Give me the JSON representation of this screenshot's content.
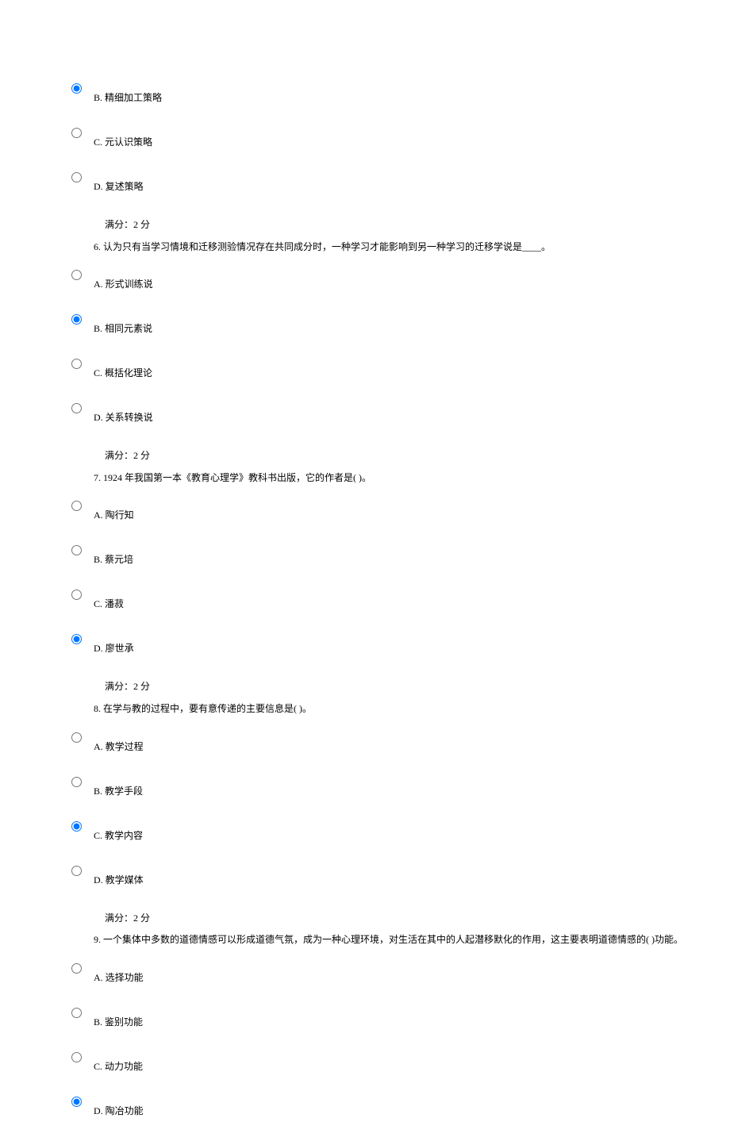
{
  "q5_remainder": {
    "options": [
      {
        "letter": "B",
        "text": "精细加工策略",
        "selected": true
      },
      {
        "letter": "C",
        "text": "元认识策略",
        "selected": false
      },
      {
        "letter": "D",
        "text": "复述策略",
        "selected": false
      }
    ],
    "score": "满分：2 分"
  },
  "q6": {
    "number": "6.",
    "stem": "认为只有当学习情境和迁移测验情况存在共同成分时，一种学习才能影响到另一种学习的迁移学说是____。",
    "options": [
      {
        "letter": "A",
        "text": "形式训练说",
        "selected": false
      },
      {
        "letter": "B",
        "text": "相同元素说",
        "selected": true
      },
      {
        "letter": "C",
        "text": "概括化理论",
        "selected": false
      },
      {
        "letter": "D",
        "text": "关系转换说",
        "selected": false
      }
    ],
    "score": "满分：2 分"
  },
  "q7": {
    "number": "7.",
    "stem": "1924 年我国第一本《教育心理学》教科书出版，它的作者是( )。",
    "options": [
      {
        "letter": "A",
        "text": "陶行知",
        "selected": false
      },
      {
        "letter": "B",
        "text": "蔡元培",
        "selected": false
      },
      {
        "letter": "C",
        "text": "潘菽",
        "selected": false
      },
      {
        "letter": "D",
        "text": "廖世承",
        "selected": true
      }
    ],
    "score": "满分：2 分"
  },
  "q8": {
    "number": "8.",
    "stem": "在学与教的过程中，要有意传递的主要信息是( )。",
    "options": [
      {
        "letter": "A",
        "text": "教学过程",
        "selected": false
      },
      {
        "letter": "B",
        "text": "教学手段",
        "selected": false
      },
      {
        "letter": "C",
        "text": "教学内容",
        "selected": true
      },
      {
        "letter": "D",
        "text": "教学媒体",
        "selected": false
      }
    ],
    "score": "满分：2 分"
  },
  "q9": {
    "number": "9.",
    "stem": "一个集体中多数的道德情感可以形成道德气氛，成为一种心理环境，对生活在其中的人起潜移默化的作用，这主要表明道德情感的( )功能。",
    "options": [
      {
        "letter": "A",
        "text": "选择功能",
        "selected": false
      },
      {
        "letter": "B",
        "text": "鉴别功能",
        "selected": false
      },
      {
        "letter": "C",
        "text": "动力功能",
        "selected": false
      },
      {
        "letter": "D",
        "text": "陶冶功能",
        "selected": true
      }
    ]
  }
}
